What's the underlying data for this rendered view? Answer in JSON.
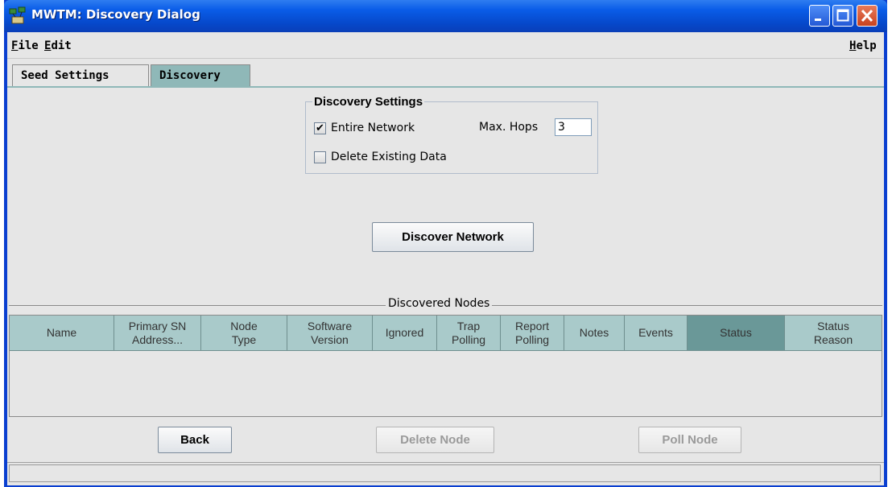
{
  "window": {
    "title": "MWTM: Discovery Dialog"
  },
  "menu": {
    "file": "File",
    "edit": "Edit",
    "help": "Help"
  },
  "tabs": [
    {
      "label": "Seed Settings",
      "selected": false
    },
    {
      "label": "Discovery",
      "selected": true
    }
  ],
  "discovery_settings": {
    "title": "Discovery Settings",
    "entire_network": {
      "label": "Entire Network",
      "checked": true,
      "mark": "✔"
    },
    "delete_existing": {
      "label": "Delete Existing Data",
      "checked": false,
      "mark": ""
    },
    "max_hops_label": "Max. Hops",
    "max_hops_value": "3"
  },
  "discover_button": "Discover Network",
  "nodes_section": {
    "title": "Discovered Nodes",
    "columns": [
      "Name",
      "Primary SN\nAddress...",
      "Node\nType",
      "Software\nVersion",
      "Ignored",
      "Trap\nPolling",
      "Report\nPolling",
      "Notes",
      "Events",
      "Status",
      "Status\nReason"
    ],
    "selected_column": "Status",
    "rows": []
  },
  "buttons": {
    "back": "Back",
    "delete_node": "Delete Node",
    "poll_node": "Poll Node"
  },
  "colors": {
    "title_bar": "#0a5de8",
    "tab_selected": "#8fb8b8",
    "column_header": "#a9caca",
    "column_header_selected": "#6a9898"
  },
  "status_text": ""
}
